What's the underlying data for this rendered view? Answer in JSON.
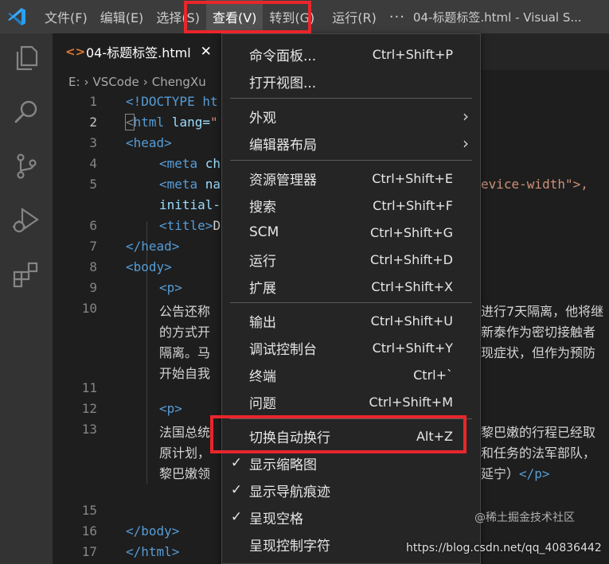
{
  "titlebar": {
    "menus": [
      "文件(F)",
      "编辑(E)",
      "选择(S)",
      "查看(V)",
      "转到(G)",
      "运行(R)"
    ],
    "more": "···",
    "window_title": "04-标题标签.html - Visual S..."
  },
  "tab": {
    "icon": "<>",
    "label": "04-标题标签.html",
    "close": "✕"
  },
  "breadcrumb": [
    "E:",
    "VSCode",
    "ChengXu"
  ],
  "breadcrumb_sep": "›",
  "editor": {
    "line_numbers": [
      "1",
      "2",
      "3",
      "4",
      "5",
      "",
      "6",
      "7",
      "8",
      "9",
      "10",
      "",
      "",
      "",
      "11",
      "12",
      "13",
      "",
      "",
      "14",
      "15",
      "16",
      "17"
    ],
    "code": {
      "l1_tag": "<!DOCTYPE ht",
      "l2_open": "<",
      "l2_tag": "html",
      "l2_attr": " lang=",
      "l2_str": "\"",
      "l3": "<head>",
      "l4_tag": "<meta ",
      "l4_attr": "ch",
      "l5_tag": "<meta ",
      "l5_attr": "na",
      "l5_str": "evice-width\">,",
      "l5b_attr": "initial-",
      "l6_tag": "<title>",
      "l6_txt": "D",
      "l7": "</head>",
      "l8": "<body>",
      "l9": "<p>",
      "l10a_left": "公告还称",
      "l10a_right": "进行7天隔离，他将继",
      "l10b_left": "的方式开",
      "l10b_right": "新泰作为密切接触者",
      "l10c_left": "隔离。马",
      "l10c_right": "现症状，但作为预防",
      "l10d_left": "开始自我",
      "l12": "<p>",
      "l13a_left": "法国总统",
      "l13a_right": "黎巴嫩的行程已经取",
      "l13b_left": "原计划，",
      "l13b_right": "和任务的法军部队，",
      "l13c_left": "黎巴嫩领",
      "l13c_right": "延宁）",
      "l13c_close": "</p>",
      "l16": "</body>",
      "l17": "</html>"
    }
  },
  "view_menu": {
    "items": [
      {
        "label": "命令面板...",
        "shortcut": "Ctrl+Shift+P"
      },
      {
        "label": "打开视图...",
        "shortcut": ""
      },
      {
        "label": "外观",
        "submenu": "›"
      },
      {
        "label": "编辑器布局",
        "submenu": "›"
      },
      {
        "label": "资源管理器",
        "shortcut": "Ctrl+Shift+E"
      },
      {
        "label": "搜索",
        "shortcut": "Ctrl+Shift+F"
      },
      {
        "label": "SCM",
        "shortcut": "Ctrl+Shift+G"
      },
      {
        "label": "运行",
        "shortcut": "Ctrl+Shift+D"
      },
      {
        "label": "扩展",
        "shortcut": "Ctrl+Shift+X"
      },
      {
        "label": "输出",
        "shortcut": "Ctrl+Shift+U"
      },
      {
        "label": "调试控制台",
        "shortcut": "Ctrl+Shift+Y"
      },
      {
        "label": "终端",
        "shortcut": "Ctrl+`"
      },
      {
        "label": "问题",
        "shortcut": "Ctrl+Shift+M"
      },
      {
        "label": "切换自动换行",
        "shortcut": "Alt+Z"
      },
      {
        "label": "显示缩略图",
        "checked": true
      },
      {
        "label": "显示导航痕迹",
        "checked": true
      },
      {
        "label": "呈现空格",
        "checked": true
      },
      {
        "label": "呈现控制字符",
        "checked": false
      }
    ],
    "check_glyph": "✓"
  },
  "watermarks": {
    "juejin": "@稀土掘金技术社区",
    "csdn": "https://blog.csdn.net/qq_40836442"
  },
  "colors": {
    "highlight": "#e8262b",
    "accent": "#007acc",
    "menu_bg": "#252526"
  }
}
